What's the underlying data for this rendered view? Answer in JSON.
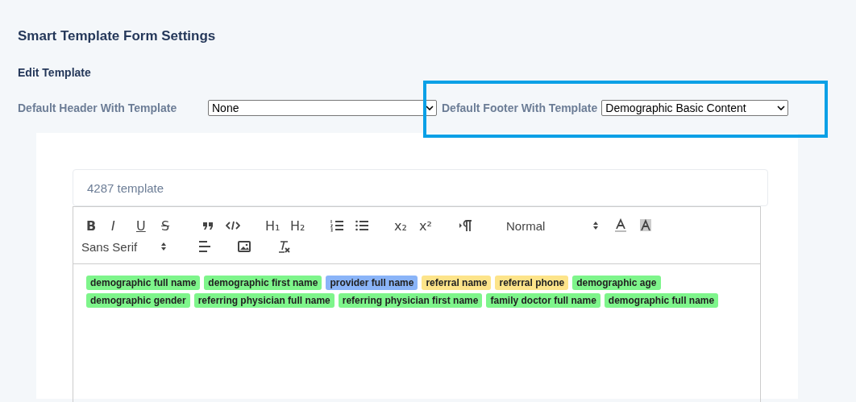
{
  "page_title": "Smart Template Form Settings",
  "section_title": "Edit Template",
  "header_select": {
    "label": "Default Header With Template",
    "value": "None"
  },
  "footer_select": {
    "label": "Default Footer With Template",
    "value": "Demographic Basic Content",
    "highlighted": true
  },
  "template_name": {
    "value": "4287 template"
  },
  "toolbar_rows": [
    [
      [
        {
          "kind": "bold",
          "label": "B"
        },
        {
          "kind": "italic",
          "label": "I"
        },
        {
          "kind": "underline",
          "label": "U"
        },
        {
          "kind": "strike",
          "label": "S"
        }
      ],
      [
        {
          "kind": "quote"
        },
        {
          "kind": "code"
        }
      ],
      [
        {
          "kind": "text",
          "label": "H₁"
        },
        {
          "kind": "text",
          "label": "H₂"
        }
      ],
      [
        {
          "kind": "ordered-list"
        },
        {
          "kind": "bullet-list"
        }
      ],
      [
        {
          "kind": "text",
          "label": "x₂"
        },
        {
          "kind": "text",
          "label": "x²"
        }
      ],
      [
        {
          "kind": "direction"
        }
      ],
      [
        {
          "kind": "picker",
          "label": "Normal"
        }
      ],
      [
        {
          "kind": "text-color"
        },
        {
          "kind": "background-color"
        }
      ]
    ],
    [
      [
        {
          "kind": "picker",
          "label": "Sans Serif"
        }
      ],
      [
        {
          "kind": "align"
        }
      ],
      [
        {
          "kind": "image"
        }
      ],
      [
        {
          "kind": "clear-format"
        }
      ]
    ]
  ],
  "tags": [
    {
      "label": "demographic full name",
      "color": "#7ef58b"
    },
    {
      "label": "demographic first name",
      "color": "#7ef58b"
    },
    {
      "label": "provider full name",
      "color": "#8ab4f8"
    },
    {
      "label": "referral name",
      "color": "#fde48a"
    },
    {
      "label": "referral phone",
      "color": "#fde48a"
    },
    {
      "label": "demographic age",
      "color": "#7ef58b"
    },
    {
      "label": "demographic gender",
      "color": "#7ef58b"
    },
    {
      "label": "referring physician full name",
      "color": "#7ef58b"
    },
    {
      "label": "referring physician first name",
      "color": "#7ef58b"
    },
    {
      "label": "family doctor full name",
      "color": "#7ef58b"
    },
    {
      "label": "demographic full name",
      "color": "#7ef58b"
    }
  ]
}
